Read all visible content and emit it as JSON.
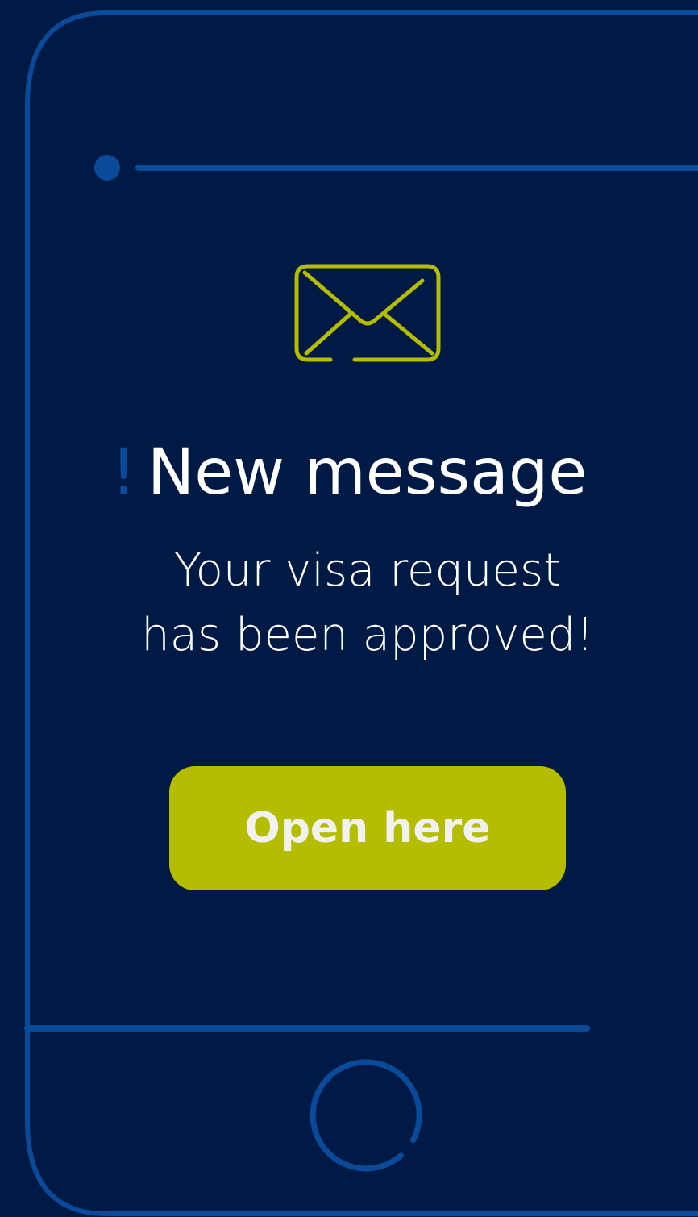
{
  "colors": {
    "background": "#001a45",
    "outline": "#0a4a9a",
    "accent": "#b5bd00",
    "text": "#ffffff"
  },
  "icons": {
    "message": "envelope-icon",
    "home": "home-button-icon",
    "camera": "camera-dot-icon"
  },
  "notification": {
    "alert_mark": "!",
    "title": "New message",
    "body_line_1": "Your visa request",
    "body_line_2": "has been approved!"
  },
  "action": {
    "button_label": "Open here"
  }
}
